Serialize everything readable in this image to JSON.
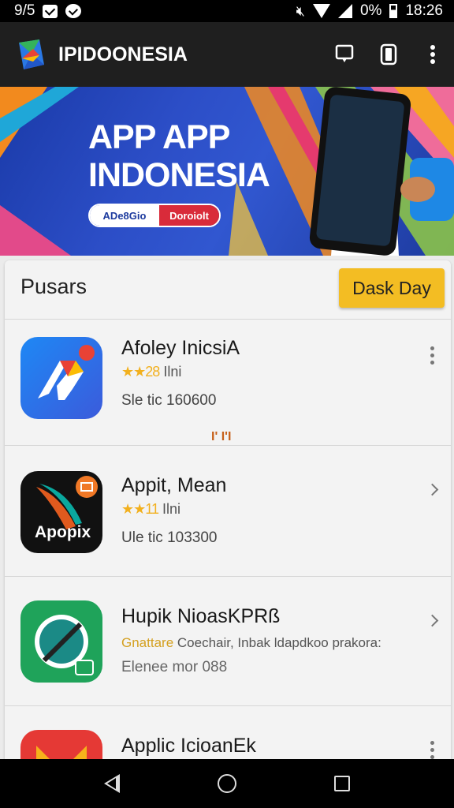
{
  "status_bar": {
    "time_left": "9/5",
    "battery": "0%",
    "clock": "18:26"
  },
  "app_bar": {
    "title": "IPIDOONESIA"
  },
  "banner": {
    "line1": "APP APP",
    "line2": "INDONESIA",
    "pill_left": "ADe8Gio",
    "pill_right": "Doroiolt"
  },
  "section": {
    "title": "Pusars",
    "button": "Dask Day"
  },
  "apps": [
    {
      "name": "Afoley InicsiA",
      "rating": "★★28",
      "rating_suffix": "Ilni",
      "meta": "Sle tic 160600",
      "badge": "I' I'I",
      "action": "more-vert"
    },
    {
      "name": "Appit, Mean",
      "rating": "★★11",
      "rating_suffix": "Ilni",
      "meta": "Ule tic 103300",
      "icon_text": "Apopix",
      "action": "chevron-right"
    },
    {
      "name": "Hupik NioasKPRß",
      "desc_highlight": "Gnattare",
      "desc": "Coechair, Inbak ldapdkoo prakora:",
      "meta": "Elenee mor 088",
      "action": "chevron-right"
    },
    {
      "name": "Applic IcioanEk",
      "action": "more-vert"
    }
  ],
  "colors": {
    "accent": "#f3bd23",
    "app_bar": "#1f1f1f",
    "banner": "#2c4ec7"
  }
}
